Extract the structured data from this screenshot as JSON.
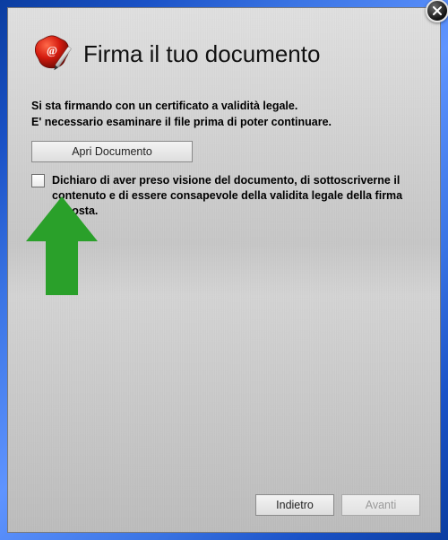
{
  "header": {
    "title": "Firma il tuo documento"
  },
  "info": {
    "line1": "Si sta firmando con un certificato a validità legale.",
    "line2": "E' necessario esaminare il file prima di poter continuare."
  },
  "buttons": {
    "open_document": "Apri Documento",
    "back": "Indietro",
    "next": "Avanti"
  },
  "declaration": {
    "text_full": "Dichiaro di aver preso visione del documento, di sottoscriverne il contenuto e di essere consapevole della validita legale della firma apposta.",
    "checked": false
  },
  "overlay": {
    "arrow_color": "#2aa02a"
  }
}
